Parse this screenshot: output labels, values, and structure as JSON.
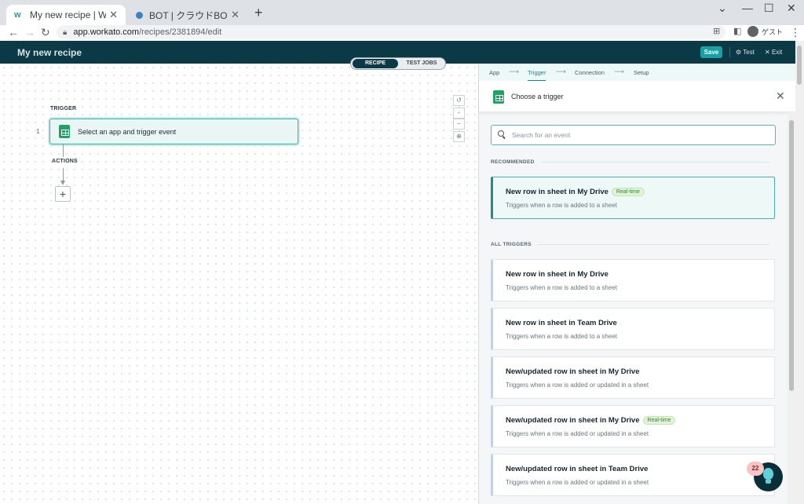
{
  "browser": {
    "tabs": [
      {
        "title": "My new recipe | Workato",
        "active": true
      },
      {
        "title": "BOT | クラウドBOT",
        "active": false
      }
    ],
    "url_host": "app.workato.com",
    "url_path": "/recipes/2381894/edit",
    "profile_label": "ゲスト"
  },
  "header": {
    "recipe_title": "My new recipe",
    "save_label": "Save",
    "test_label": "Test",
    "exit_label": "Exit"
  },
  "canvas": {
    "toggle": {
      "recipe": "RECIPE",
      "test_jobs": "TEST JOBS"
    },
    "trigger_label": "TRIGGER",
    "step_number": "1",
    "trigger_card_text": "Select an app and trigger event",
    "actions_label": "ACTIONS"
  },
  "panel": {
    "steps": [
      "App",
      "Trigger",
      "Connection",
      "Setup"
    ],
    "current_step": "Trigger",
    "choose_title": "Choose a trigger",
    "search_placeholder": "Search for an event",
    "recommended_label": "RECOMMENDED",
    "recommended": [
      {
        "title": "New row in sheet in My Drive",
        "badge": "Real-time",
        "desc": "Triggers when a row is added to a sheet"
      }
    ],
    "all_label": "ALL TRIGGERS",
    "triggers": [
      {
        "title": "New row in sheet in My Drive",
        "badge": "",
        "desc": "Triggers when a row is added to a sheet"
      },
      {
        "title": "New row in sheet in Team Drive",
        "badge": "",
        "desc": "Triggers when a row is added to a sheet"
      },
      {
        "title": "New/updated row in sheet in My Drive",
        "badge": "",
        "desc": "Triggers when a row is added or updated in a sheet"
      },
      {
        "title": "New/updated row in sheet in My Drive",
        "badge": "Real-time",
        "desc": "Triggers when a row is added or updated in a sheet"
      },
      {
        "title": "New/updated row in sheet in Team Drive",
        "badge": "",
        "desc": "Triggers when a row is added or updated in a sheet"
      }
    ]
  },
  "help": {
    "notification_count": "22"
  },
  "colors": {
    "header_bg": "#0b3945",
    "accent": "#18a0a7",
    "sheets_green": "#1ea362"
  }
}
